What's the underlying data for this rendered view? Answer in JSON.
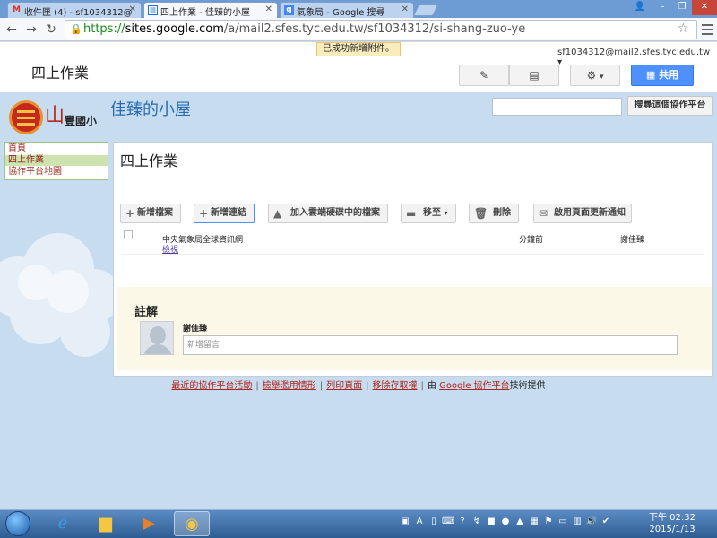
{
  "browser": {
    "tabs": [
      {
        "title": "收件匣 (4) - sf1034312@",
        "favicon": "gmail-icon"
      },
      {
        "title": "四上作業 - 佳臻的小屋",
        "favicon": "sites-icon"
      },
      {
        "title": "氣象局 - Google 搜尋",
        "favicon": "google-icon"
      }
    ],
    "url_scheme": "https://",
    "url_host": "sites.google.com",
    "url_path": "/a/mail2.sfes.tyc.edu.tw/sf1034312/si-shang-zuo-ye"
  },
  "notice": "已成功新增附件。",
  "sites": {
    "page_title": "四上作業",
    "account": "sf1034312@mail2.sfes.tyc.edu.tw",
    "share_label": "共用"
  },
  "header": {
    "school_char": "山",
    "school_name": "豐國小",
    "site_name": "佳臻的小屋",
    "search_button": "搜尋這個協作平台"
  },
  "sidebar": {
    "items": [
      {
        "label": "首頁"
      },
      {
        "label": "四上作業"
      },
      {
        "label": "協作平台地圖"
      }
    ]
  },
  "main": {
    "title": "四上作業",
    "actions": {
      "add_file": "新增檔案",
      "add_link": "新增連結",
      "add_drive": "加入雲端硬碟中的檔案",
      "move_to": "移至",
      "delete": "刪除",
      "notify": "啟用頁面更新通知"
    },
    "files": [
      {
        "name": "中央氣象局全球資訊網",
        "view": "檢視",
        "time": "一分鐘前",
        "user": "謝佳臻"
      }
    ]
  },
  "comments": {
    "title": "註解",
    "user": "謝佳臻",
    "placeholder": "新增留言"
  },
  "footer": {
    "recent": "最近的協作平台活動",
    "report": "檢舉濫用情形",
    "print": "列印頁面",
    "remove_access": "移除存取權",
    "by": "由",
    "powered": "Google 協作平台",
    "tail": "技術提供"
  },
  "taskbar": {
    "time": "下午 02:32",
    "date": "2015/1/13"
  }
}
